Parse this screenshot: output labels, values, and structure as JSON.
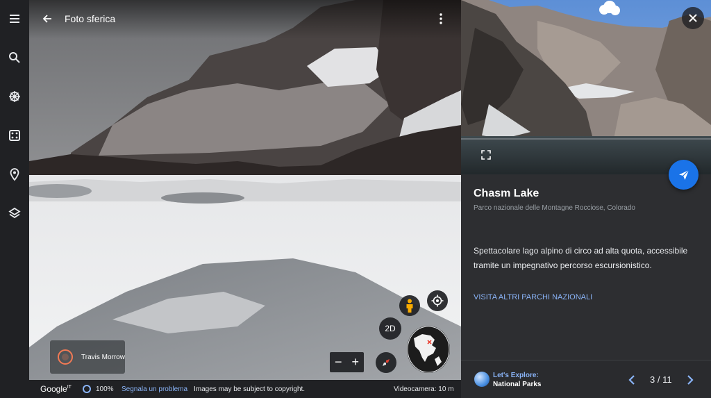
{
  "header": {
    "title": "Foto sferica"
  },
  "sidebar": {
    "items": [
      {
        "icon": "menu-icon"
      },
      {
        "icon": "search-icon"
      },
      {
        "icon": "voyager-icon"
      },
      {
        "icon": "feeling-lucky-dice-icon"
      },
      {
        "icon": "projects-pin-icon"
      },
      {
        "icon": "map-style-layers-icon"
      }
    ]
  },
  "street_view": {
    "contributor": "Travis Morrow",
    "mode_2d_label": "2D",
    "zoom_out_label": "−",
    "zoom_in_label": "+"
  },
  "footer": {
    "brand": "Google",
    "brand_suffix": "IT",
    "zoom_percent": "100%",
    "report_link": "Segnala un problema",
    "copyright": "Images may be subject to copyright.",
    "camera": "Videocamera: 10 m"
  },
  "panel": {
    "name": "Chasm Lake",
    "subtitle": "Parco nazionale delle Montagne Rocciose, Colorado",
    "description": "Spettacolare lago alpino di circo ad alta quota, accessibile tramite un impegnativo percorso escursionistico.",
    "link": "VISITA ALTRI PARCHI NAZIONALI",
    "collection_title": "Let's Explore:",
    "collection_subtitle": "National Parks",
    "pager": "3 / 11"
  },
  "colors": {
    "accent": "#1a73e8",
    "link": "#8ab4f8",
    "panel_bg": "#2d2e31",
    "rail_bg": "#202124"
  }
}
